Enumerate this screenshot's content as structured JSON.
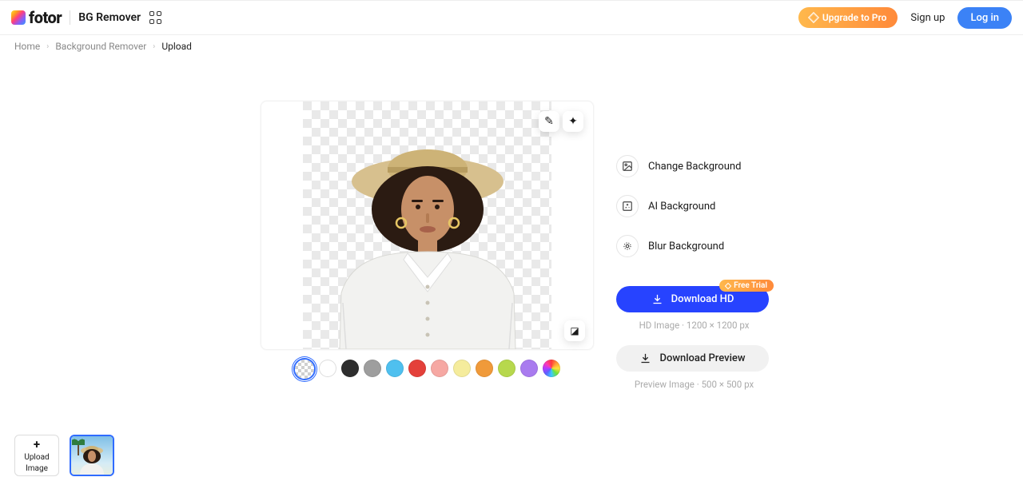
{
  "header": {
    "logo_text": "fotor",
    "tool_name": "BG Remover",
    "upgrade": "Upgrade to Pro",
    "signup": "Sign up",
    "login": "Log in"
  },
  "breadcrumb": {
    "home": "Home",
    "level2": "Background Remover",
    "current": "Upload"
  },
  "canvas": {
    "swatches": [
      {
        "name": "transparent"
      },
      {
        "name": "white",
        "hex": "#ffffff"
      },
      {
        "name": "black",
        "hex": "#2e2e2e"
      },
      {
        "name": "gray",
        "hex": "#9e9e9e"
      },
      {
        "name": "sky",
        "hex": "#4fc0ef"
      },
      {
        "name": "red",
        "hex": "#e4403a"
      },
      {
        "name": "pink",
        "hex": "#f6a8a3"
      },
      {
        "name": "lemon",
        "hex": "#f5ec9c"
      },
      {
        "name": "orange",
        "hex": "#f09a3a"
      },
      {
        "name": "lime",
        "hex": "#b7d84d"
      },
      {
        "name": "violet",
        "hex": "#a97bef"
      },
      {
        "name": "rainbow"
      }
    ],
    "selected_swatch": 0
  },
  "panel": {
    "opt_change_bg": "Change Background",
    "opt_ai_bg": "AI Background",
    "opt_blur_bg": "Blur Background",
    "download_hd": "Download HD",
    "hd_meta": "HD Image · 1200 × 1200 px",
    "download_preview": "Download Preview",
    "preview_meta": "Preview Image · 500 × 500 px",
    "free_trial_badge": "Free Trial"
  },
  "thumbs": {
    "upload_line1": "Upload",
    "upload_line2": "Image"
  }
}
